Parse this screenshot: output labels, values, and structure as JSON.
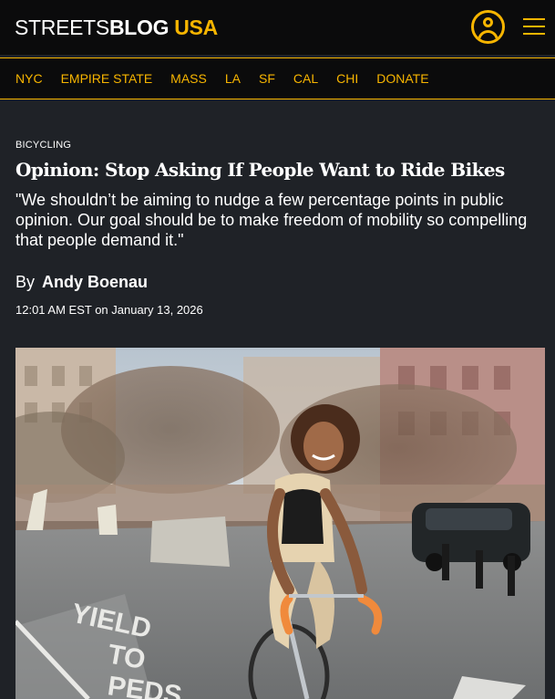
{
  "header": {
    "logo": {
      "part1": "STREETS",
      "part2": "BLOG",
      "part3": "USA"
    },
    "icons": {
      "user": "user-account-icon",
      "menu": "hamburger-menu-icon"
    }
  },
  "nav": {
    "items": [
      {
        "label": "NYC"
      },
      {
        "label": "EMPIRE STATE"
      },
      {
        "label": "MASS"
      },
      {
        "label": "LA"
      },
      {
        "label": "SF"
      },
      {
        "label": "CAL"
      },
      {
        "label": "CHI"
      },
      {
        "label": "DONATE"
      }
    ]
  },
  "article": {
    "category": "BICYCLING",
    "headline": "Opinion: Stop Asking If People Want to Ride Bikes",
    "dek": "\"We shouldn’t be aiming to nudge a few percentage points in public opinion. Our goal should be to make freedom of mobility so compelling that people demand it.\"",
    "by_label": "By",
    "author": "Andy Boenau",
    "dateline": "12:01 AM EST on January 13, 2026",
    "hero_image": "woman-riding-bike-photo"
  },
  "colors": {
    "accent": "#f7b500",
    "header_bg": "#0b0b0c",
    "page_bg": "#1f2227",
    "text": "#ffffff"
  }
}
